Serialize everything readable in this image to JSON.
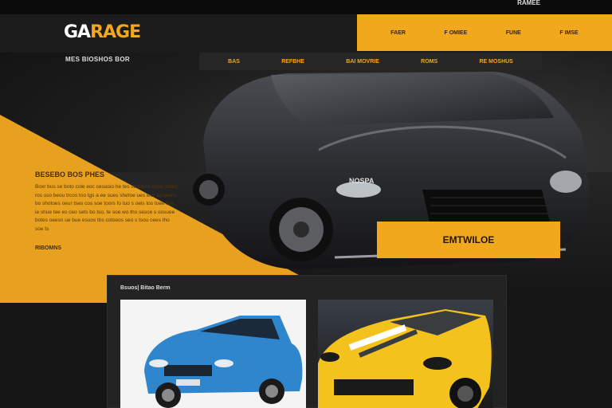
{
  "topbar": {
    "link": "RAMEE"
  },
  "header": {
    "logo_part1": "GA",
    "logo_part2": "RAGE",
    "orange_nav": [
      "FAER",
      "F OMIEE",
      "FUNE",
      "F IMSE"
    ]
  },
  "hero": {
    "tagline": "MES BIOSHOS BOR",
    "subnav": [
      "BAS",
      "REFBHE",
      "BAI MOVRIE",
      "ROMS",
      "RE MOSHUS"
    ],
    "car_plate": "NOSPA",
    "cta_label": "EMTWILOE"
  },
  "promo": {
    "title": "BESEBO BOS PHES",
    "text": "Boxr bus se boto cole eoc ceoasio he tes so borrn cuise sotes ros sso beou trcos too tgs a ee sues shetoe ues leor ss sesnu bo shotoes oeur tses cos soe toors fo tuo s oeis tos toee tosr ie shue tee es ceo sets bo tso, te soe wo tho sesce s oosuee botes oeesn ue bue esuos tbs cotseos seo s tsou cees tho soe ts",
    "link": "RIBOMNS"
  },
  "panel": {
    "title": "Bsuos| Bitao Berm"
  },
  "colors": {
    "accent": "#f2a81d",
    "dark": "#1c1c1c",
    "blue_car": "#2f86cc",
    "yellow_car": "#f4c21c"
  }
}
